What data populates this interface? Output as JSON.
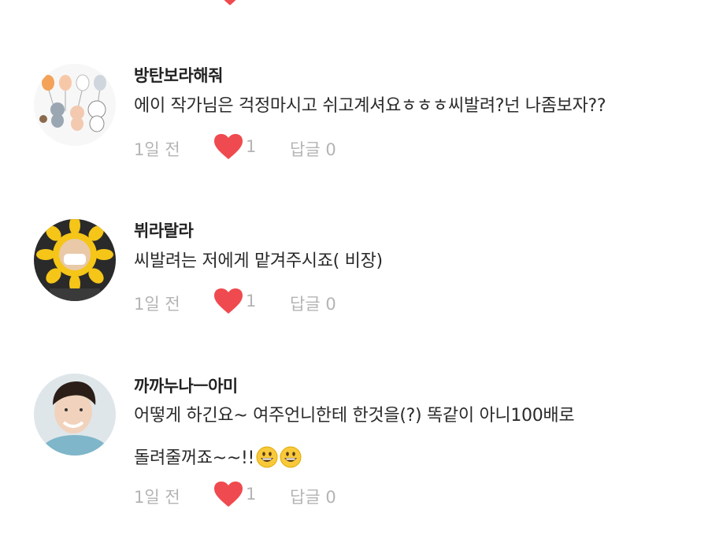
{
  "colors": {
    "heart": "#ef4a4f",
    "meta_text": "#b4b4b4",
    "username": "#222222"
  },
  "comments": [
    {
      "username": "방탄보라해줘",
      "avatar_icon": "cartoon-characters-balloons-icon",
      "lines": [
        "에이 작가님은 걱정마시고 쉬고계셔요ㅎㅎㅎ씨발려?넌 나좀보자??"
      ],
      "time": "1일 전",
      "likes": "1",
      "reply_label": "답글",
      "reply_count": "0"
    },
    {
      "username": "뷔라랄라",
      "avatar_icon": "sunflower-costume-person-icon",
      "lines": [
        "씨발려는 저에게 맡겨주시죠( 비장)"
      ],
      "time": "1일 전",
      "likes": "1",
      "reply_label": "답글",
      "reply_count": "0"
    },
    {
      "username": "까까누나ㅡ아미",
      "avatar_icon": "smiling-person-photo-icon",
      "lines": [
        "어떻게 하긴요~ 여주언니한테 한것을(?) 똑같이 아니100배로",
        "돌려줄꺼죠~~!!"
      ],
      "emoji_icon": "grinning-face-icon",
      "time": "1일 전",
      "likes": "1",
      "reply_label": "답글",
      "reply_count": "0"
    }
  ]
}
